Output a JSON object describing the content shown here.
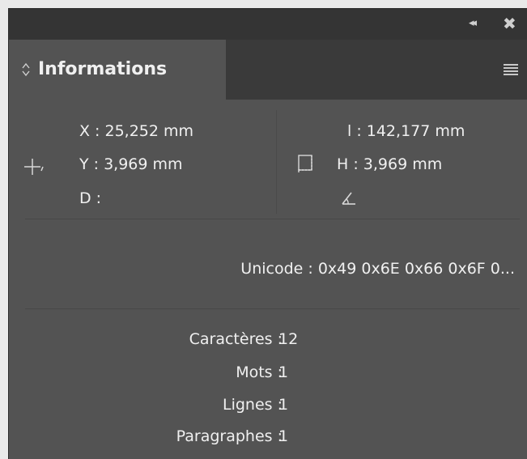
{
  "panel": {
    "title": "Informations",
    "icons": {
      "collapse": "double-chevron-left-icon",
      "close": "close-icon",
      "menu": "hamburger-menu-icon",
      "tab_arrows": "up-down-arrows-icon",
      "crosshair": "crosshair-icon",
      "bounding_box": "bounding-box-icon",
      "angle": "angle-icon"
    },
    "glyphs": {
      "collapse": "◂◂",
      "close": "✖"
    }
  },
  "position": {
    "x": "X : 25,252 mm",
    "y": "Y : 3,969 mm",
    "d": "D :"
  },
  "size": {
    "width": "l : 142,177 mm",
    "height": "H : 3,969 mm"
  },
  "unicode": "Unicode : 0x49 0x6E 0x66 0x6F 0...",
  "stats": {
    "characters_label": "Caractères :",
    "characters_value": "12",
    "words_label": "Mots :",
    "words_value": "1",
    "lines_label": "Lignes :",
    "lines_value": "1",
    "paragraphs_label": "Paragraphes :",
    "paragraphs_value": "1"
  }
}
